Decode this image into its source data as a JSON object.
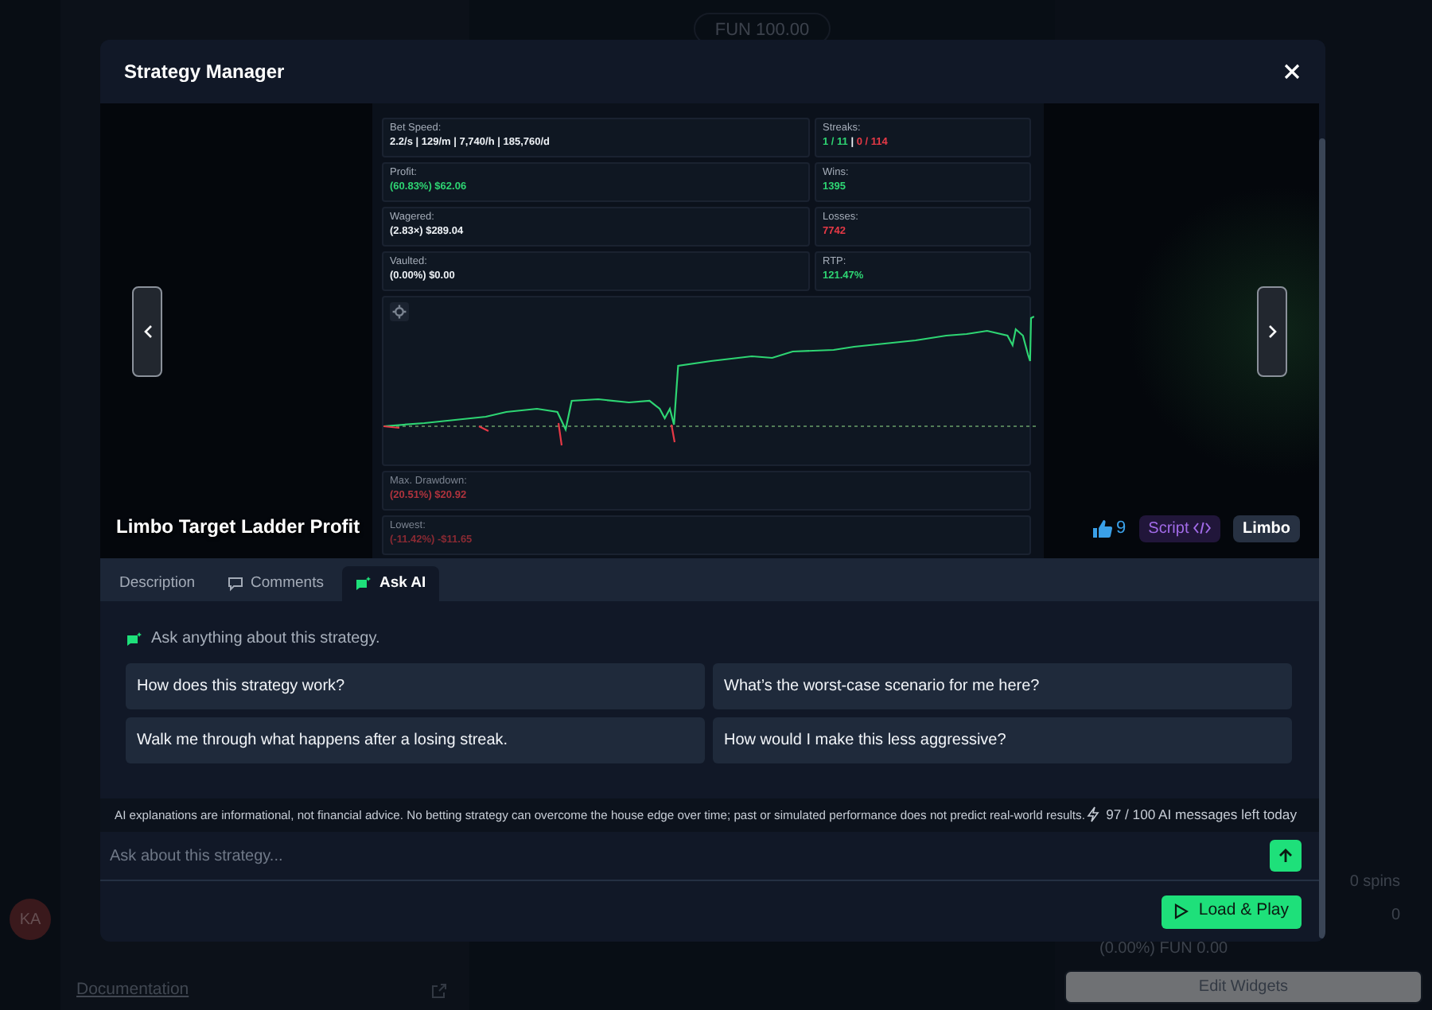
{
  "background": {
    "balance": "FUN 100.00",
    "avatar": "KA",
    "documentation_link": "Documentation",
    "right_rows": [
      {
        "label": "0 spins"
      },
      {
        "label": "0"
      }
    ],
    "profit_line": "(0.00%) FUN 0.00",
    "edit_widgets": "Edit Widgets"
  },
  "modal": {
    "title": "Strategy Manager",
    "preview": {
      "stats": [
        {
          "label": "Bet Speed:",
          "parts": [
            {
              "text": "2.2/s | 129/m | 7,740/h | 185,760/d"
            }
          ]
        },
        {
          "label": "Streaks:",
          "parts": [
            {
              "text": "1 / 11",
              "color": "#2ed573"
            },
            {
              "text": " | "
            },
            {
              "text": "0 / 114",
              "color": "#e63946"
            }
          ]
        },
        {
          "label": "Profit:",
          "parts": [
            {
              "text": "(60.83%) $62.06",
              "color": "#2ed573"
            }
          ]
        },
        {
          "label": "Wins:",
          "parts": [
            {
              "text": "1395",
              "color": "#2ed573"
            }
          ]
        },
        {
          "label": "Wagered:",
          "parts": [
            {
              "text": "(2.83×) $289.04"
            }
          ]
        },
        {
          "label": "Losses:",
          "parts": [
            {
              "text": "7742",
              "color": "#e63946"
            }
          ]
        },
        {
          "label": "Vaulted:",
          "parts": [
            {
              "text": "(0.00%) $0.00"
            }
          ]
        },
        {
          "label": "RTP:",
          "parts": [
            {
              "text": "121.47%",
              "color": "#2ed573"
            }
          ]
        }
      ],
      "after_chart": [
        {
          "label": "Max. Drawdown:",
          "parts": [
            {
              "text": "(20.51%) $20.92",
              "color": "#b0333d"
            }
          ]
        },
        {
          "label": "Lowest:",
          "parts": [
            {
              "text": "(-11.42%) -$11.65",
              "color": "#8a2a33"
            }
          ]
        }
      ]
    },
    "strategy": {
      "name": "Limbo Target Ladder Profit",
      "likes": "9",
      "tags": [
        {
          "label": "Script",
          "kind": "script"
        },
        {
          "label": "Limbo",
          "kind": "game"
        }
      ]
    },
    "tabs": [
      {
        "label": "Description",
        "selected": false
      },
      {
        "label": "Comments",
        "selected": false
      },
      {
        "label": "Ask AI",
        "selected": true
      }
    ],
    "ask_ai": {
      "intro": "Ask anything about this strategy.",
      "suggestions": [
        "How does this strategy work?",
        "What’s the worst-case scenario for me here?",
        "Walk me through what happens after a losing streak.",
        "How would I make this less aggressive?"
      ],
      "disclaimer": "AI explanations are informational, not financial advice. No betting strategy can overcome the house edge over time; past or simulated performance does not predict real-world results.",
      "quota": "97 / 100 AI messages left today",
      "input": {
        "placeholder": "Ask about this strategy..."
      }
    },
    "primary_button": "Load & Play"
  }
}
